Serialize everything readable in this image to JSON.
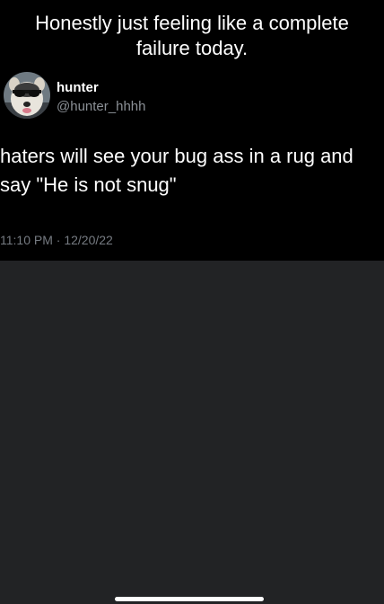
{
  "meme": {
    "caption": "Honestly just feeling like a complete\nfailure today."
  },
  "tweet": {
    "author": {
      "name": "hunter",
      "handle": "@hunter_hhhh",
      "avatar_icon": "dog-with-sunglasses-avatar"
    },
    "text": "haters will see your bug ass in a rug and\nsay \"He is not snug\"",
    "meta": "11:10 PM · 12/20/22"
  },
  "colors": {
    "tweet_background": "#000000",
    "page_background": "#222325",
    "secondary_text": "#8b9096"
  }
}
